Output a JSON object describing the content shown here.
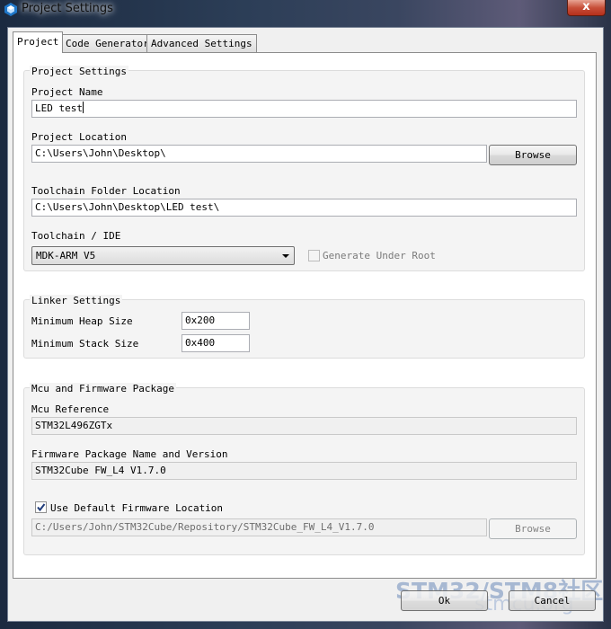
{
  "window": {
    "title": "Project Settings",
    "close_label": "x"
  },
  "tabs": [
    {
      "label": "Project",
      "active": true
    },
    {
      "label": "Code Generator",
      "active": false
    },
    {
      "label": "Advanced Settings",
      "active": false
    }
  ],
  "project_settings": {
    "group_title": "Project Settings",
    "name_label": "Project Name",
    "name_value": "LED test",
    "location_label": "Project Location",
    "location_value": "C:\\Users\\John\\Desktop\\",
    "browse_label": "Browse",
    "toolchain_folder_label": "Toolchain Folder Location",
    "toolchain_folder_value": "C:\\Users\\John\\Desktop\\LED test\\",
    "toolchain_label": "Toolchain / IDE",
    "toolchain_selected": "MDK-ARM V5",
    "generate_under_root_label": "Generate Under Root",
    "generate_under_root_checked": false
  },
  "linker_settings": {
    "group_title": "Linker Settings",
    "heap_label": "Minimum Heap Size",
    "heap_value": "0x200",
    "stack_label": "Minimum Stack Size",
    "stack_value": "0x400"
  },
  "mcu_firmware": {
    "group_title": "Mcu and Firmware Package",
    "mcu_reference_label": "Mcu Reference",
    "mcu_reference_value": "STM32L496ZGTx",
    "firmware_label": "Firmware Package Name and Version",
    "firmware_value": "STM32Cube FW_L4 V1.7.0",
    "use_default_label": "Use Default Firmware Location",
    "use_default_checked": true,
    "firmware_location_value": "C:/Users/John/STM32Cube/Repository/STM32Cube_FW_L4_V1.7.0",
    "browse_label": "Browse"
  },
  "footer": {
    "ok_label": "Ok",
    "cancel_label": "Cancel"
  },
  "watermark": {
    "main": "STM32/STM8社区",
    "sub": "stmcu.org"
  },
  "colors": {
    "accent_blue": "#1f77c9",
    "window_frame": "#2c3e57",
    "panel_bg": "#f4f4f4"
  }
}
